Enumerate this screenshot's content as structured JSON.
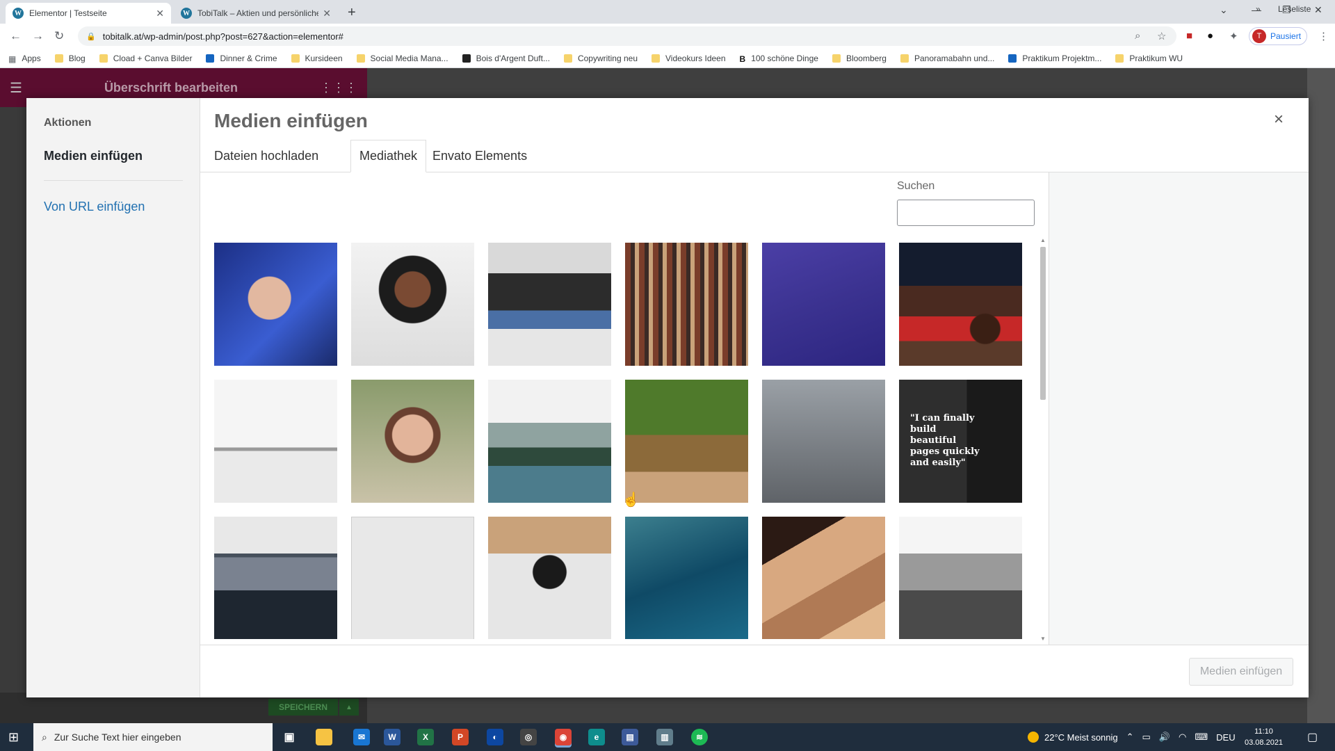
{
  "browser": {
    "tabs": [
      {
        "title": "Elementor | Testseite",
        "favicon": "wordpress-icon",
        "active": true
      },
      {
        "title": "TobiTalk – Aktien und persönliche",
        "favicon": "wordpress-icon",
        "active": false
      }
    ],
    "url": "tobitalk.at/wp-admin/post.php?post=627&action=elementor#",
    "profile_label": "Pausiert",
    "profile_initial": "T",
    "bookmarks": [
      {
        "label": "Apps",
        "icon": "apps-grid-icon"
      },
      {
        "label": "Blog",
        "icon": "folder-icon"
      },
      {
        "label": "Cload + Canva Bilder",
        "icon": "folder-icon"
      },
      {
        "label": "Dinner & Crime",
        "icon": "jd-icon"
      },
      {
        "label": "Kursideen",
        "icon": "folder-icon"
      },
      {
        "label": "Social Media Mana...",
        "icon": "folder-icon"
      },
      {
        "label": "Bois d'Argent Duft...",
        "icon": "bois-icon"
      },
      {
        "label": "Copywriting neu",
        "icon": "folder-icon"
      },
      {
        "label": "Videokurs Ideen",
        "icon": "folder-icon"
      },
      {
        "label": "100 schöne Dinge",
        "icon": "b-icon"
      },
      {
        "label": "Bloomberg",
        "icon": "folder-icon"
      },
      {
        "label": "Panoramabahn und...",
        "icon": "folder-icon"
      },
      {
        "label": "Praktikum Projektm...",
        "icon": "j-icon"
      },
      {
        "label": "Praktikum WU",
        "icon": "folder-icon"
      }
    ],
    "bookmarks_more": "»",
    "reading_list": "Leseliste"
  },
  "editor": {
    "panel_title": "Überschrift bearbeiten",
    "save_label": "SPEICHERN"
  },
  "modal": {
    "sidebar_heading": "Aktionen",
    "sidebar_items": [
      {
        "label": "Medien einfügen",
        "active": true
      },
      {
        "label": "Von URL einfügen",
        "active": false
      }
    ],
    "title": "Medien einfügen",
    "close_icon": "×",
    "tabs": [
      {
        "label": "Dateien hochladen",
        "active": false
      },
      {
        "label": "Mediathek",
        "active": true
      },
      {
        "label": "Envato Elements",
        "active": false
      }
    ],
    "search_label": "Suchen",
    "search_value": "",
    "insert_button": "Medien einfügen",
    "media_items": [
      {
        "name": "man-with-glasses-photo"
      },
      {
        "name": "woman-curly-hair-photo"
      },
      {
        "name": "developer-at-monitors-photo"
      },
      {
        "name": "library-shelves-photo"
      },
      {
        "name": "purple-abstract-photo"
      },
      {
        "name": "writing-notebook-photo"
      },
      {
        "name": "bright-office-stools-photo"
      },
      {
        "name": "woman-portrait-photo"
      },
      {
        "name": "misty-mountain-lake-photo"
      },
      {
        "name": "tree-path-photo"
      },
      {
        "name": "road-cars-aerial-photo"
      },
      {
        "name": "testimonial-quote-image",
        "text": "\"I can finally build beautiful pages quickly and easily\""
      },
      {
        "name": "sailboats-lake-photo"
      },
      {
        "name": "blank-gray-image"
      },
      {
        "name": "photographer-camera-photo"
      },
      {
        "name": "ocean-wave-photo"
      },
      {
        "name": "desert-dunes-photo"
      },
      {
        "name": "city-skyline-photo"
      }
    ]
  },
  "taskbar": {
    "search_placeholder": "Zur Suche Text hier eingeben",
    "weather": "22°C  Meist sonnig",
    "language": "DEU",
    "time": "11:10",
    "date": "03.08.2021"
  },
  "colors": {
    "wp_blue": "#2271b1",
    "elementor_header": "#5a0d2f",
    "taskbar": "#1f2d3d"
  }
}
